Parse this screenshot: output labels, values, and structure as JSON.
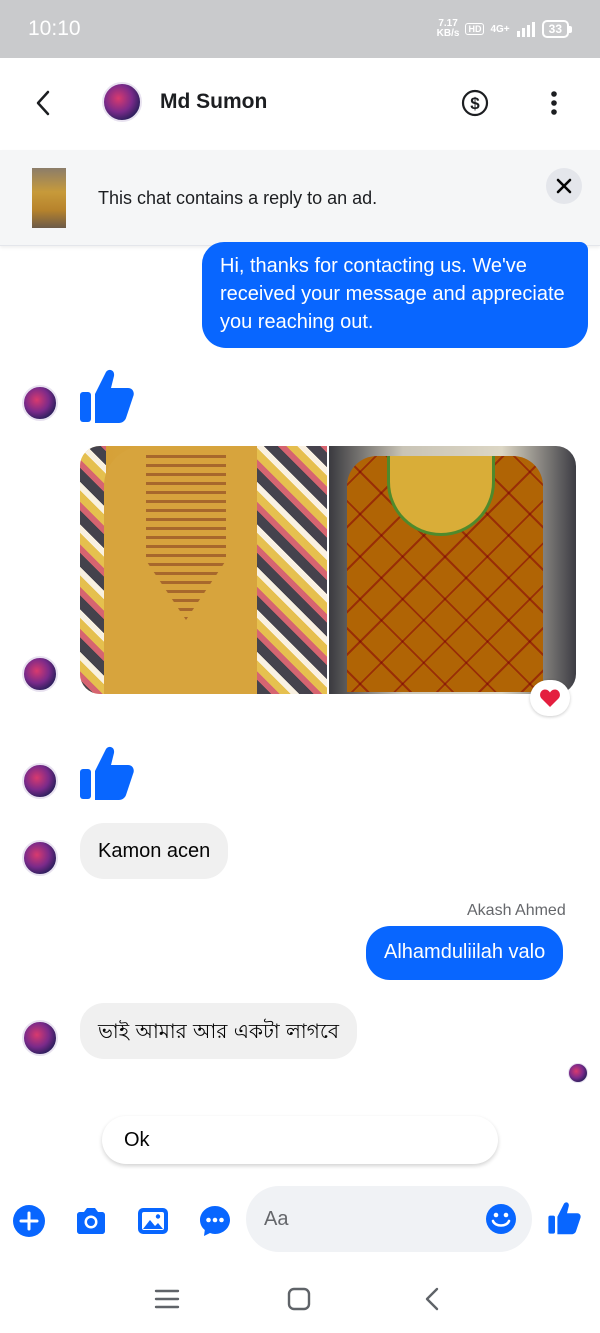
{
  "status_bar": {
    "time": "10:10",
    "net_speed_value": "7.17",
    "net_speed_unit": "KB/s",
    "hd": "HD",
    "network": "4G+",
    "battery": "33"
  },
  "header": {
    "contact_name": "Md Sumon",
    "icons": [
      "back-arrow-icon",
      "dollar-icon",
      "more-vertical-icon"
    ]
  },
  "ad_banner": {
    "text": "This chat contains a reply to an ad."
  },
  "messages": {
    "outgoing_1": "Hi, thanks for contacting us. We've received your message and appreciate you reaching out.",
    "incoming_text_1": "Kamon acen",
    "sender_name": "Akash Ahmed",
    "outgoing_2": "Alhamduliilah valo",
    "incoming_text_2": "ভাই আমার আর একটা লাগবে",
    "photo_reaction": "heart"
  },
  "quick_reply": {
    "label": "Ok"
  },
  "composer": {
    "placeholder": "Aa",
    "icons": [
      "plus-icon",
      "camera-icon",
      "image-icon",
      "chat-bubble-icon",
      "emoji-icon",
      "like-icon"
    ]
  },
  "colors": {
    "brand_blue": "#0866ff",
    "incoming_bubble": "#f0f0f0",
    "status_bar": "#c9cacc",
    "heart_red": "#e41e3f"
  }
}
